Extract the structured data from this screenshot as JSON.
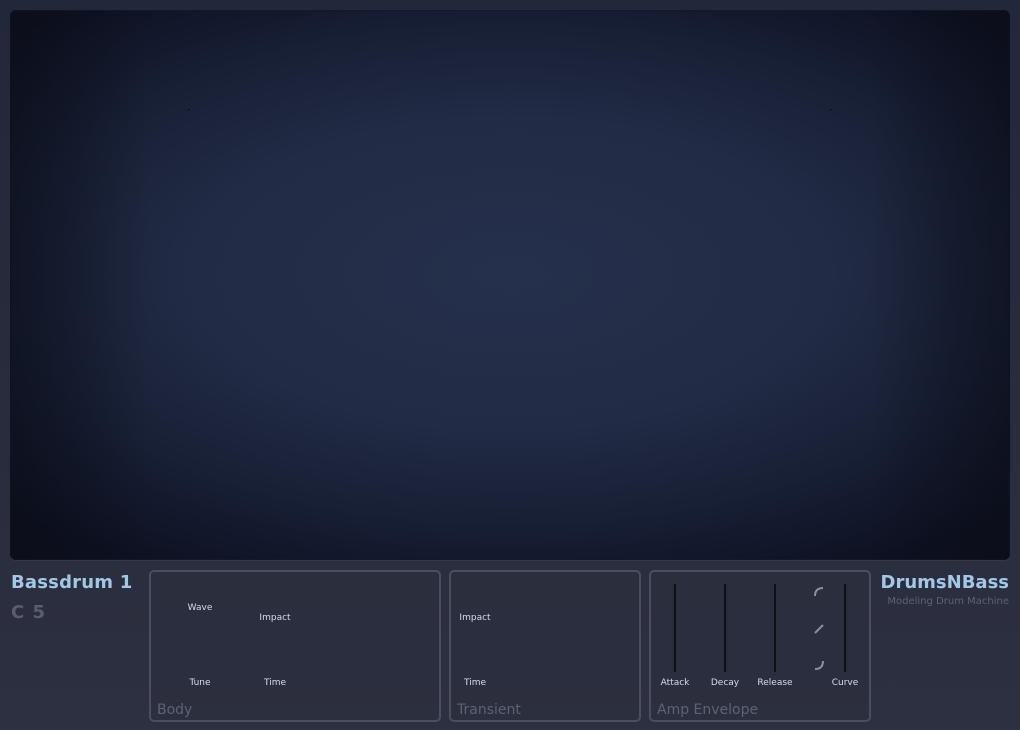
{
  "display": {},
  "preset": {
    "name": "Bassdrum 1",
    "note": "C 5"
  },
  "brand": {
    "title": "DrumsNBass",
    "subtitle": "Modeling Drum Machine"
  },
  "panels": {
    "body": {
      "title": "Body",
      "controls": {
        "wave": "Wave",
        "impact": "Impact",
        "tune": "Tune",
        "time": "Time"
      }
    },
    "transient": {
      "title": "Transient",
      "controls": {
        "impact": "Impact",
        "time": "Time"
      }
    },
    "amp_envelope": {
      "title": "Amp Envelope",
      "controls": {
        "attack": "Attack",
        "decay": "Decay",
        "release": "Release",
        "curve": "Curve"
      }
    }
  },
  "icons": {
    "curve_shapes": [
      "curve-exponential-icon",
      "curve-linear-icon",
      "curve-logarithmic-icon"
    ]
  },
  "colors": {
    "accent": "#a3c8e6",
    "muted": "#595e6e",
    "panel_border": "#4a4e60",
    "display_bg": "#222b45"
  }
}
